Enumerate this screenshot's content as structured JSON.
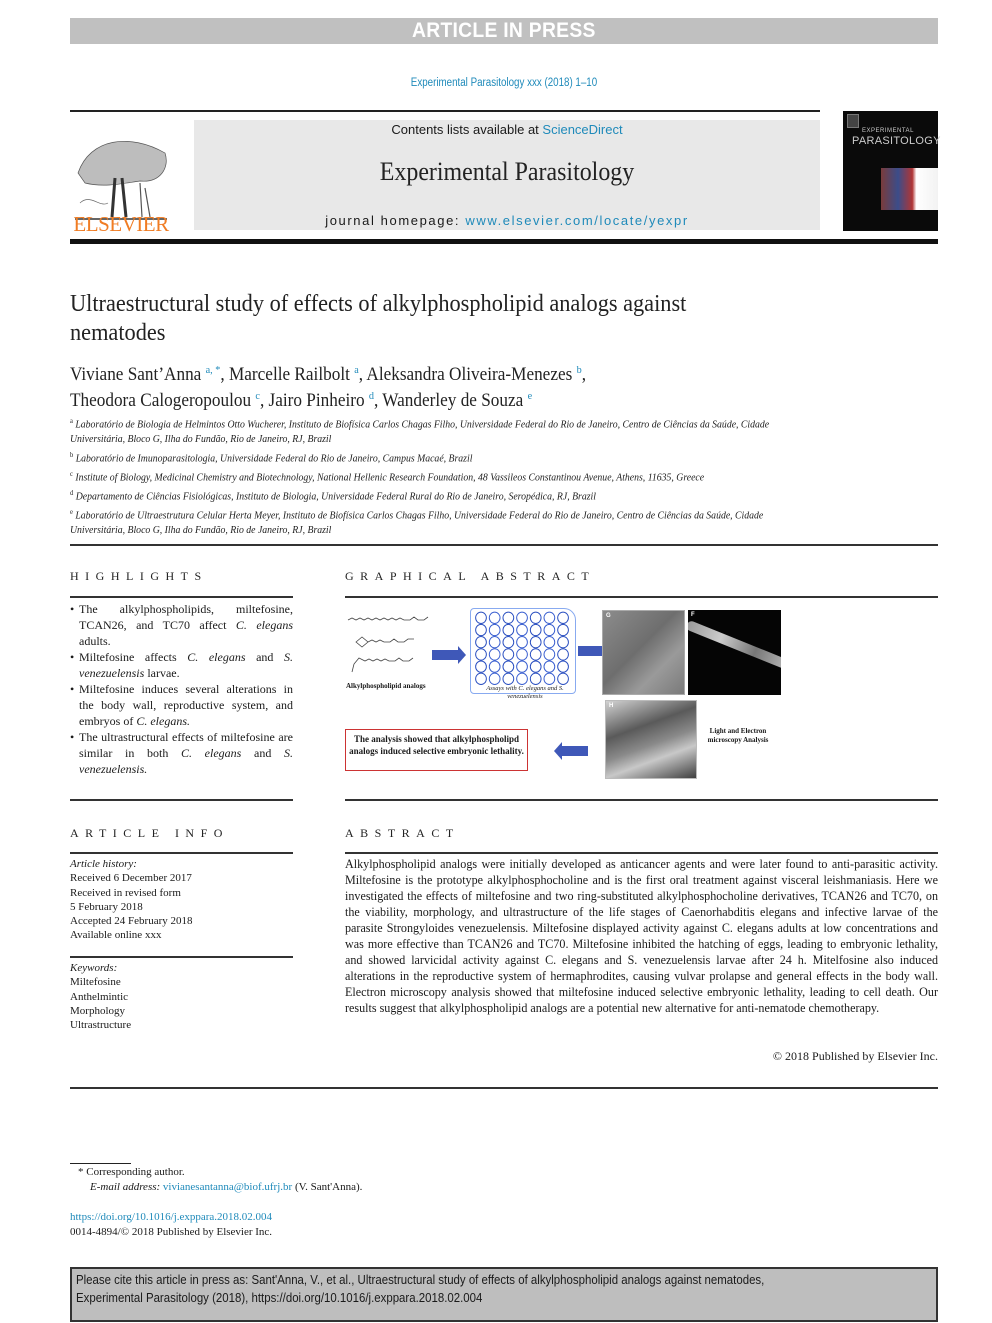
{
  "banner": "ARTICLE IN PRESS",
  "journal_ref": "Experimental Parasitology xxx (2018) 1–10",
  "header": {
    "contents_prefix": "Contents lists available at ",
    "contents_link": "ScienceDirect",
    "journal_title": "Experimental Parasitology",
    "homepage_prefix": "journal homepage: ",
    "homepage_link": "www.elsevier.com/locate/yexpr",
    "publisher_logo_text": "ELSEVIER",
    "cover_small": "EXPERIMENTAL",
    "cover_big": "PARASITOLOGY"
  },
  "colors": {
    "link": "#1f8aba",
    "elsevier_orange": "#f07c23",
    "banner_grey": "#c0c0c0",
    "arrow_blue": "#3f58b8",
    "conclusion_border": "#cc3333"
  },
  "title": "Ultraestructural study of effects of alkylphospholipid analogs against nematodes",
  "authors": [
    {
      "name": "Viviane Sant’Anna",
      "aff": "a, *"
    },
    {
      "name": "Marcelle Railbolt",
      "aff": "a"
    },
    {
      "name": "Aleksandra Oliveira-Menezes",
      "aff": "b"
    },
    {
      "name": "Theodora Calogeropoulou",
      "aff": "c"
    },
    {
      "name": "Jairo Pinheiro",
      "aff": "d"
    },
    {
      "name": "Wanderley de Souza",
      "aff": "e"
    }
  ],
  "affiliations": [
    {
      "key": "a",
      "text": "Laboratório de Biologia de Helmintos Otto Wucherer, Instituto de Biofísica Carlos Chagas Filho, Universidade Federal do Rio de Janeiro, Centro de Ciências da Saúde, Cidade Universitária, Bloco G, Ilha do Fundão, Rio de Janeiro, RJ, Brazil"
    },
    {
      "key": "b",
      "text": "Laboratório de Imunoparasitologia, Universidade Federal do Rio de Janeiro, Campus Macaé, Brazil"
    },
    {
      "key": "c",
      "text": "Institute of Biology, Medicinal Chemistry and Biotechnology, National Hellenic Research Foundation, 48 Vassileos Constantinou Avenue, Athens, 11635, Greece"
    },
    {
      "key": "d",
      "text": "Departamento de Ciências Fisiológicas, Instituto de Biologia, Universidade Federal Rural do Rio de Janeiro, Seropédica, RJ, Brazil"
    },
    {
      "key": "e",
      "text": "Laboratório de Ultraestrutura Celular Herta Meyer, Instituto de Biofísica Carlos Chagas Filho, Universidade Federal do Rio de Janeiro, Centro de Ciências da Saúde, Cidade Universitária, Bloco G, Ilha do Fundão, Rio de Janeiro, RJ, Brazil"
    }
  ],
  "highlights": {
    "heading": "HIGHLIGHTS",
    "items": [
      "The alkylphospholipids, miltefosine, TCAN26, and TC70 affect C. elegans adults.",
      "Miltefosine affects C. elegans and S. venezuelensis larvae.",
      "Miltefosine induces several alterations in the body wall, reproductive system, and embryos of C. elegans.",
      "The ultrastructural effects of miltefosine are similar in both C. elegans and S. venezuelensis."
    ]
  },
  "graphical_abstract": {
    "heading": "GRAPHICAL ABSTRACT",
    "chem_label": "Alkylphospholipid analogs",
    "plate_label": "Assays with C. elegans and S. venezuelensis",
    "micro_label": "Light and Electron microscopy Analysis",
    "panel_letters": [
      "G",
      "F",
      "H"
    ],
    "conclusion": "The analysis showed that alkylphospholipd analogs induced selective embryonic lethality."
  },
  "article_info": {
    "heading": "ARTICLE INFO",
    "history_label": "Article history:",
    "history": [
      "Received 6 December 2017",
      "Received in revised form",
      "5 February 2018",
      "Accepted 24 February 2018",
      "Available online xxx"
    ],
    "keywords_label": "Keywords:",
    "keywords": [
      "Miltefosine",
      "Anthelmintic",
      "Morphology",
      "Ultrastructure"
    ]
  },
  "abstract": {
    "heading": "ABSTRACT",
    "text": "Alkylphospholipid analogs were initially developed as anticancer agents and were later found to anti-parasitic activity. Miltefosine is the prototype alkylphosphocholine and is the first oral treatment against visceral leishmaniasis. Here we investigated the effects of miltefosine and two ring-substituted alkylphosphocholine derivatives, TCAN26 and TC70, on the viability, morphology, and ultrastructure of the life stages of Caenorhabditis elegans and infective larvae of the parasite Strongyloides venezuelensis. Miltefosine displayed activity against C. elegans adults at low concentrations and was more effective than TCAN26 and TC70. Miltefosine inhibited the hatching of eggs, leading to embryonic lethality, and showed larvicidal activity against C. elegans and S. venezuelensis larvae after 24 h. Mitelfosine also induced alterations in the reproductive system of hermaphrodites, causing vulvar prolapse and general effects in the body wall. Electron microscopy analysis showed that miltefosine induced selective embryonic lethality, leading to cell death. Our results suggest that alkylphospholipid analogs are a potential new alternative for anti-nematode chemotherapy.",
    "copyright": "© 2018 Published by Elsevier Inc."
  },
  "footnotes": {
    "corresponding": "* Corresponding author.",
    "email_label": "E-mail address: ",
    "email": "vivianesantanna@biof.ufrj.br",
    "email_suffix": " (V. Sant'Anna).",
    "doi": "https://doi.org/10.1016/j.exppara.2018.02.004",
    "issn": "0014-4894/© 2018 Published by Elsevier Inc."
  },
  "citation_box": {
    "line1": "Please cite this article in press as: Sant'Anna, V., et al., Ultraestructural study of effects of alkylphospholipid analogs against nematodes,",
    "line2": "Experimental Parasitology (2018), https://doi.org/10.1016/j.exppara.2018.02.004"
  }
}
